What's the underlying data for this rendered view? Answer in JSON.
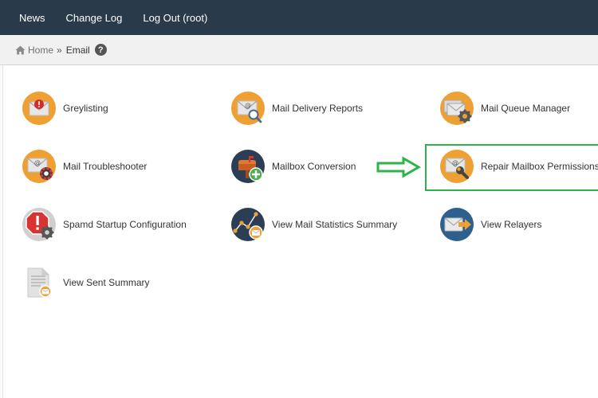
{
  "topnav": {
    "news": "News",
    "changelog": "Change Log",
    "logout": "Log Out (root)"
  },
  "breadcrumb": {
    "home": "Home",
    "separator": "»",
    "current": "Email",
    "help": "?"
  },
  "items": [
    {
      "label": "Greylisting",
      "icon": "envelope-alert-icon"
    },
    {
      "label": "Mail Delivery Reports",
      "icon": "envelope-search-icon"
    },
    {
      "label": "Mail Queue Manager",
      "icon": "mail-queue-icon"
    },
    {
      "label": "Mail Troubleshooter",
      "icon": "lifebuoy-icon"
    },
    {
      "label": "Mailbox Conversion",
      "icon": "mailbox-add-icon"
    },
    {
      "label": "Repair Mailbox Permissions",
      "icon": "wrench-icon"
    },
    {
      "label": "Spamd Startup Configuration",
      "icon": "stop-gear-icon"
    },
    {
      "label": "View Mail Statistics Summary",
      "icon": "statistics-icon"
    },
    {
      "label": "View Relayers",
      "icon": "relayer-arrow-icon"
    },
    {
      "label": "View Sent Summary",
      "icon": "sent-document-icon"
    }
  ],
  "colors": {
    "topbar": "#293a4a",
    "accent_orange": "#eea033",
    "highlight_green": "#2db34a"
  }
}
